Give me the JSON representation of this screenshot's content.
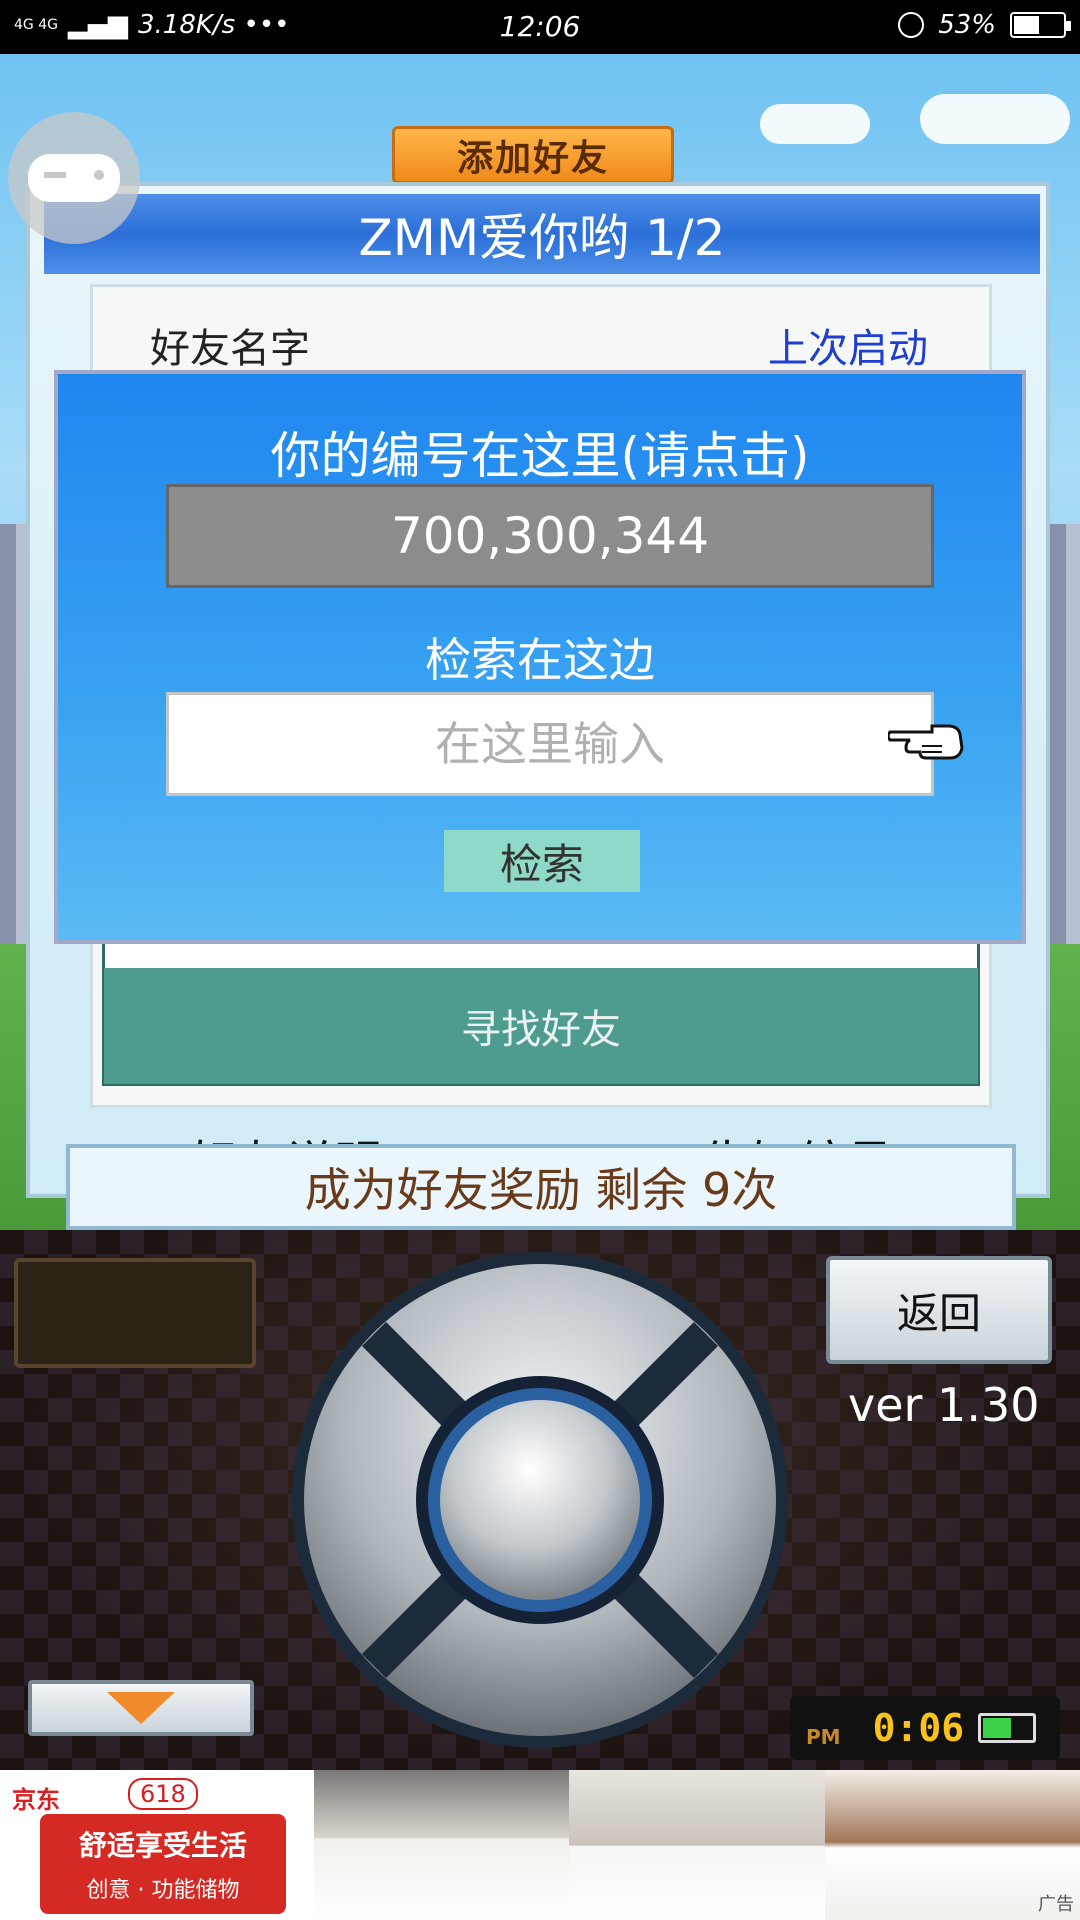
{
  "status_bar": {
    "network": "4G 4G",
    "speed": "3.18K/s •••",
    "time": "12:06",
    "battery": "53%",
    "battery_level": 0.53
  },
  "game": {
    "top_tab": "添加好友",
    "panel": {
      "title": "ZMM爱你哟 1/2",
      "col_friend_name": "好友名字",
      "col_last_launch": "上次启动",
      "find_friend": "寻找好友",
      "friend_help": "好友说明",
      "tell_id": "告知编号"
    },
    "reward": "成为好友奖励 剩余 9次",
    "popup": {
      "title": "你的编号在这里(请点击)",
      "id_value": "700,300,344",
      "search_label": "检索在这边",
      "search_placeholder": "在这里输入",
      "search_button": "检索"
    }
  },
  "controller": {
    "back": "返回",
    "version": "ver 1.30",
    "clock_period": "PM",
    "clock_time": "0:06"
  },
  "ad": {
    "brand": "京东",
    "promo": "618",
    "headline": "舒适享受生活",
    "subline": "创意 · 功能储物",
    "label": "广告"
  },
  "colors": {
    "header_blue": "#2b6fd8",
    "popup_blue": "#1f86ef",
    "find_bar": "#4e9b8f",
    "search_button": "#8ed9c8",
    "last_launch_text": "#1f3ed1"
  }
}
